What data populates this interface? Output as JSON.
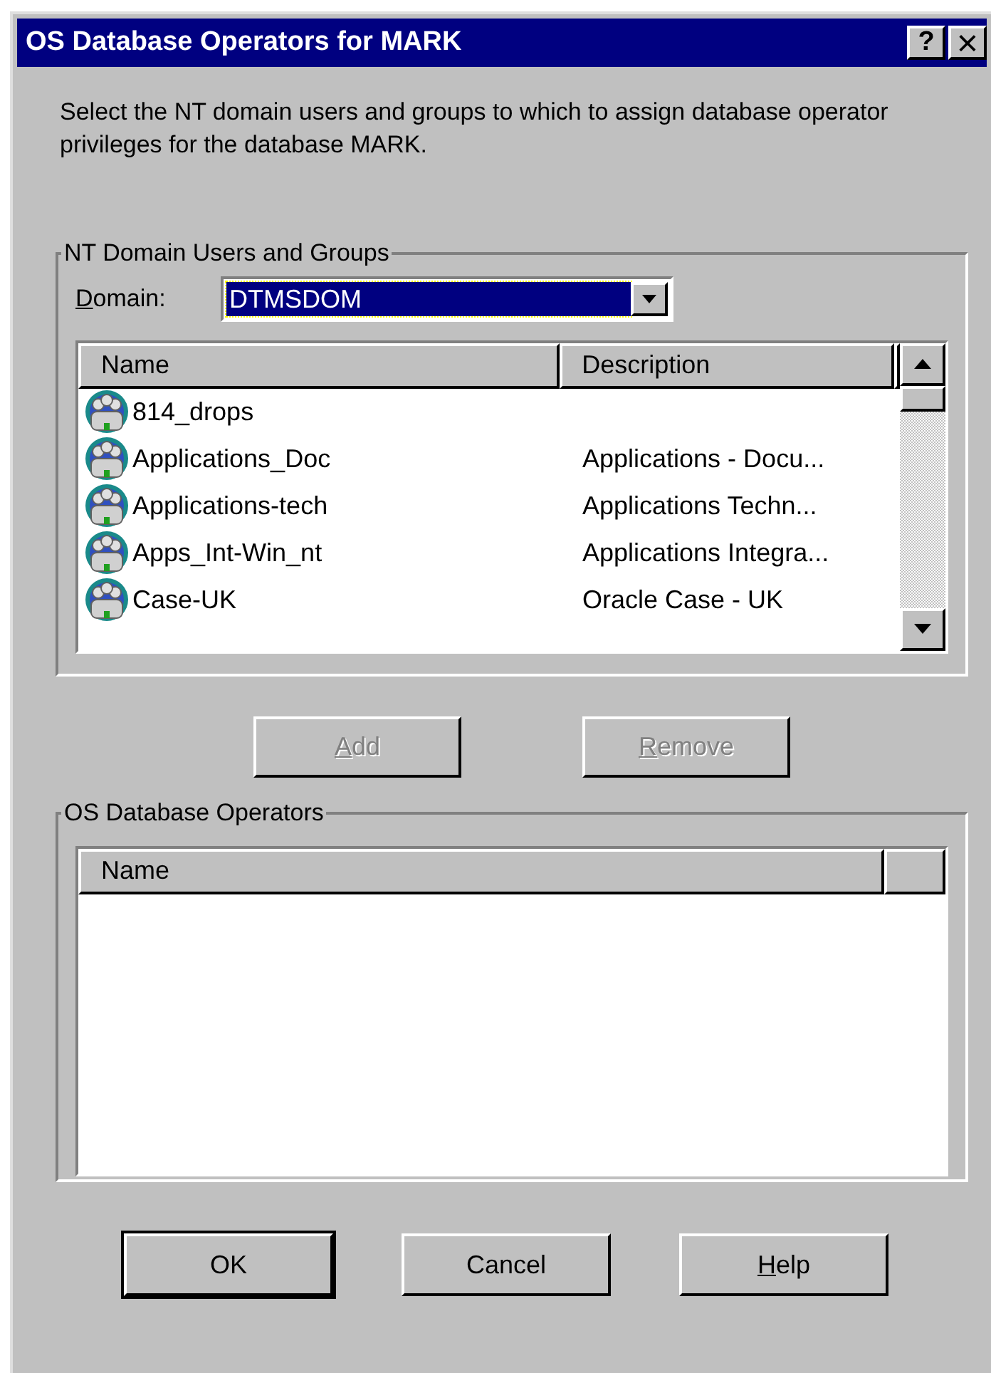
{
  "window": {
    "title": "OS Database Operators for MARK",
    "title_buttons": [
      {
        "kind": "help",
        "label": "?"
      },
      {
        "kind": "close",
        "label": "×"
      }
    ]
  },
  "instruction": "Select the NT domain users and groups to which to assign database operator privileges for the database MARK.",
  "users_group": {
    "title": "NT Domain Users and Groups",
    "domain": {
      "label": "Domain:",
      "underline_first": true,
      "value": "DTMSDOM",
      "focused": true
    },
    "columns": [
      "Name",
      "Description"
    ],
    "rows": [
      {
        "name": "814_drops"
      },
      {
        "name": "Applications_Doc",
        "description": "Applications - Docu..."
      },
      {
        "name": "Applications-tech",
        "description": "Applications Techn..."
      },
      {
        "name": "Apps_Int-Win_nt",
        "description": "Applications Integra..."
      },
      {
        "name": "Case-UK",
        "description": "Oracle Case - UK"
      }
    ]
  },
  "transfer_buttons": [
    {
      "label": "Add",
      "underline_first": true,
      "disabled": true
    },
    {
      "label": "Remove",
      "underline_first": true,
      "disabled": true
    }
  ],
  "operators_group": {
    "title": "OS Database Operators",
    "columns": [
      "Name"
    ]
  },
  "buttons": [
    {
      "label": "OK",
      "default": true
    },
    {
      "label": "Cancel"
    },
    {
      "label": "Help",
      "underline_first": true
    }
  ]
}
